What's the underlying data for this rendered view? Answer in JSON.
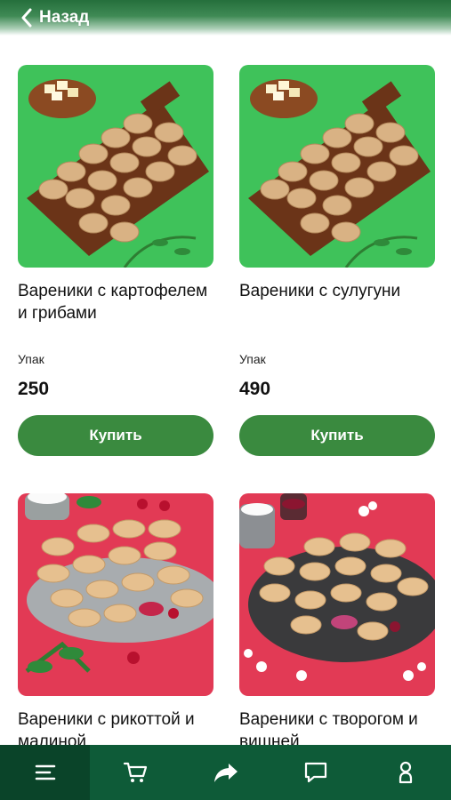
{
  "header": {
    "back_label": "Назад",
    "back_icon": "chevron-left-icon"
  },
  "products": [
    {
      "title": "Вареники с картофелем и грибами",
      "unit": "Упак",
      "price": "250",
      "buy_label": "Купить"
    },
    {
      "title": "Вареники с сулугуни",
      "unit": "Упак",
      "price": "490",
      "buy_label": "Купить"
    },
    {
      "title": "Вареники с рикоттой и малиной",
      "unit": "",
      "price": "",
      "buy_label": ""
    },
    {
      "title": "Вареники с творогом и вишней",
      "unit": "",
      "price": "",
      "buy_label": ""
    }
  ],
  "tabbar": {
    "items": [
      "menu-icon",
      "cart-icon",
      "share-icon",
      "chat-icon",
      "profile-icon"
    ],
    "active_index": 0
  },
  "colors": {
    "accent": "#3a8a3f",
    "tabbar": "#0e5b38",
    "photo_green": "#3fc25a",
    "photo_red": "#e23a55"
  }
}
